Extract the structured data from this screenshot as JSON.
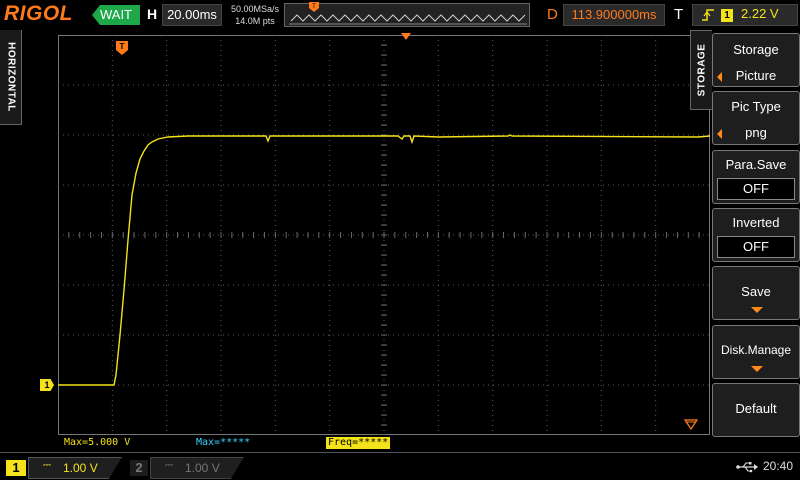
{
  "header": {
    "brand": "RIGOL",
    "run_status": "WAIT",
    "horizontal_label": "H",
    "timebase": "20.00ms",
    "sample_rate": "50.00MSa/s",
    "memory_depth": "14.0M pts",
    "delay_label": "D",
    "delay_value": "113.900000ms",
    "trigger_label": "T",
    "trigger_source": "1",
    "trigger_level": "2.22 V",
    "trigger_edge_icon": "rising-edge-icon"
  },
  "left_tab": {
    "label": "HORIZONTAL"
  },
  "waveform": {
    "channel_marker": "1",
    "trigger_position_marker": "T",
    "color": "#f4e21a"
  },
  "measurements": {
    "max_ch1": "Max=5.000 V",
    "max_ch2": "Max=*****",
    "freq": "Freq=*****"
  },
  "channels": [
    {
      "id": "1",
      "coupling": "⎓",
      "scale": "1.00 V",
      "active": true
    },
    {
      "id": "2",
      "coupling": "⎓",
      "scale": "1.00 V",
      "active": false
    }
  ],
  "status_bar": {
    "usb_icon": "usb-icon",
    "time": "20:40"
  },
  "menu": {
    "tab_label": "STORAGE",
    "items": [
      {
        "title": "Storage",
        "value": "Picture"
      },
      {
        "title": "Pic Type",
        "value": "png"
      },
      {
        "title": "Para.Save",
        "value": "OFF"
      },
      {
        "title": "Inverted",
        "value": "OFF"
      },
      {
        "title": "Save"
      },
      {
        "title": "Disk.Manage"
      },
      {
        "title": "Default"
      }
    ]
  },
  "colors": {
    "accent": "#ff7a1a",
    "ch1": "#f4e21a",
    "ch2": "#3fd3ff",
    "run_status": "#1fa84a"
  }
}
